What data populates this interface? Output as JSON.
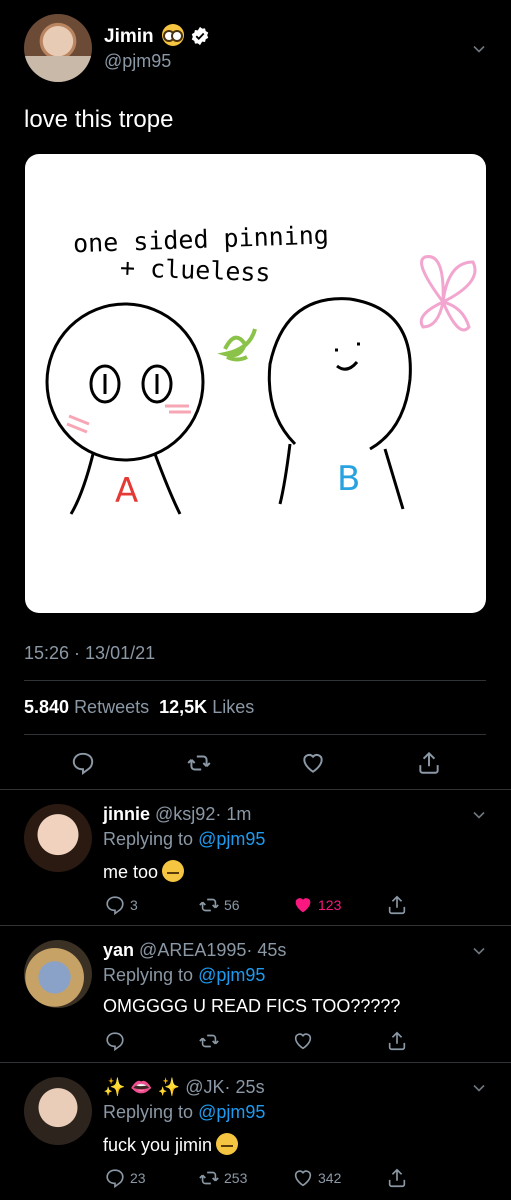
{
  "tweet": {
    "author_name": "Jimin",
    "author_handle": "@pjm95",
    "text": "love this trope",
    "timestamp": "15:26 · 13/01/21",
    "retweets_count": "5.840",
    "retweets_label": "Retweets",
    "likes_count": "12,5K",
    "likes_label": "Likes",
    "image": {
      "line1": "one sided pinning",
      "line2": "+ clueless",
      "label_a": "A",
      "label_b": "B"
    }
  },
  "replies": [
    {
      "name": "jinnie",
      "handle": "@ksj92",
      "time": "· 1m",
      "replying_label": "Replying to",
      "replying_to": "@pjm95",
      "text": "me too",
      "reply_count": "3",
      "retweet_count": "56",
      "like_count": "123",
      "liked": true
    },
    {
      "name": "yan",
      "handle": "@AREA1995",
      "time": "· 45s",
      "replying_label": "Replying to",
      "replying_to": "@pjm95",
      "text": "OMGGGG U READ FICS TOO?????",
      "reply_count": "",
      "retweet_count": "",
      "like_count": "",
      "liked": false
    },
    {
      "name": "✨ 👄 ✨",
      "handle": "@JK",
      "time": "· 25s",
      "replying_label": "Replying to",
      "replying_to": "@pjm95",
      "text": "fuck you jimin",
      "reply_count": "23",
      "retweet_count": "253",
      "like_count": "342",
      "liked": false
    }
  ],
  "colors": {
    "background": "#000000",
    "secondary_text": "#8b98a5",
    "mention": "#1d9bf0",
    "like": "#f91880",
    "divider": "#2f3336"
  }
}
